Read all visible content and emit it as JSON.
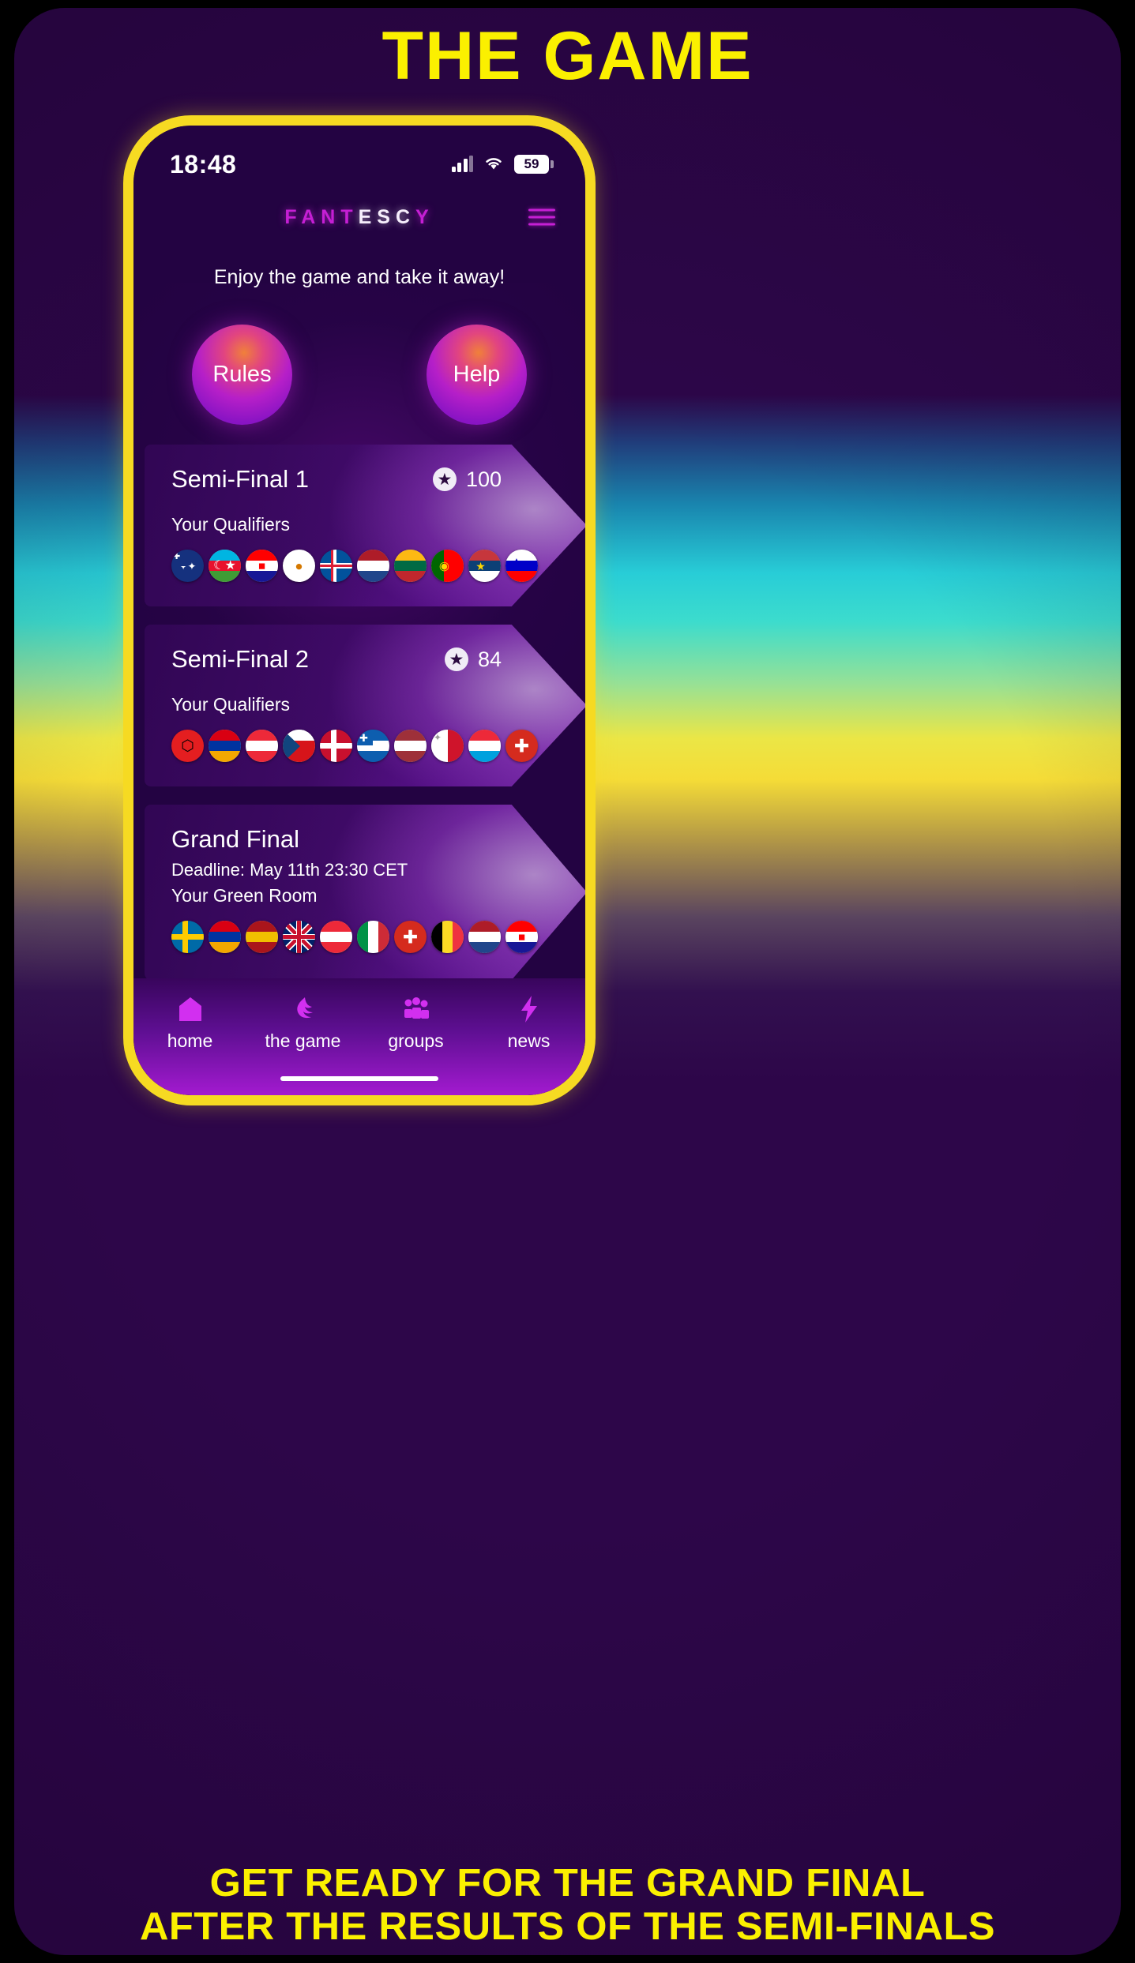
{
  "poster": {
    "headline": "THE GAME",
    "caption_line1": "GET READY FOR THE GRAND FINAL",
    "caption_line2": "AFTER THE RESULTS OF THE SEMI-FINALS",
    "accent_yellow": "#fbf000",
    "frame_yellow": "#f6da22",
    "background_purple": "#2d0649"
  },
  "status_bar": {
    "time": "18:48",
    "signal_icon": "cellular-signal-icon",
    "wifi_icon": "wifi-icon",
    "battery_level": "59"
  },
  "app_header": {
    "logo_part1": "FANT",
    "logo_part2": "ESC",
    "logo_part3": "Y",
    "menu_icon": "hamburger-menu-icon"
  },
  "tagline": "Enjoy the game and take it away!",
  "orbs": [
    {
      "label": "Rules",
      "name": "rules-button"
    },
    {
      "label": "Help",
      "name": "help-button"
    }
  ],
  "cards": [
    {
      "title": "Semi-Final 1",
      "score": "100",
      "star_icon": "star-badge-icon",
      "subtitle": "Your Qualifiers",
      "deadline": "",
      "flags": [
        {
          "country": "Australia",
          "code": "AU"
        },
        {
          "country": "Azerbaijan",
          "code": "AZ"
        },
        {
          "country": "Croatia",
          "code": "HR"
        },
        {
          "country": "Cyprus",
          "code": "CY"
        },
        {
          "country": "Iceland",
          "code": "IS"
        },
        {
          "country": "Netherlands",
          "code": "NL"
        },
        {
          "country": "Lithuania",
          "code": "LT"
        },
        {
          "country": "Portugal",
          "code": "PT"
        },
        {
          "country": "Serbia",
          "code": "RS"
        },
        {
          "country": "Slovenia",
          "code": "SI"
        }
      ]
    },
    {
      "title": "Semi-Final 2",
      "score": "84",
      "star_icon": "star-badge-icon",
      "subtitle": "Your Qualifiers",
      "deadline": "",
      "flags": [
        {
          "country": "Albania",
          "code": "AL"
        },
        {
          "country": "Armenia",
          "code": "AM"
        },
        {
          "country": "Austria",
          "code": "AT"
        },
        {
          "country": "Czechia",
          "code": "CZ"
        },
        {
          "country": "Denmark",
          "code": "DK"
        },
        {
          "country": "Greece",
          "code": "GR"
        },
        {
          "country": "Latvia",
          "code": "LV"
        },
        {
          "country": "Malta",
          "code": "MT"
        },
        {
          "country": "Luxembourg",
          "code": "LU"
        },
        {
          "country": "Switzerland",
          "code": "CH"
        }
      ]
    },
    {
      "title": "Grand Final",
      "score": "",
      "star_icon": "",
      "subtitle": "Your Green Room",
      "deadline": "Deadline: May 11th 23:30 CET",
      "flags": [
        {
          "country": "Sweden",
          "code": "SE"
        },
        {
          "country": "Armenia",
          "code": "AM"
        },
        {
          "country": "Spain",
          "code": "ES"
        },
        {
          "country": "United Kingdom",
          "code": "GB"
        },
        {
          "country": "Austria",
          "code": "AT"
        },
        {
          "country": "Italy",
          "code": "IT"
        },
        {
          "country": "Switzerland",
          "code": "CH"
        },
        {
          "country": "Belgium",
          "code": "BE"
        },
        {
          "country": "Netherlands",
          "code": "NL"
        },
        {
          "country": "Croatia",
          "code": "HR"
        }
      ]
    }
  ],
  "bottom_nav": [
    {
      "label": "home",
      "icon": "home-icon"
    },
    {
      "label": "the game",
      "icon": "bird-icon"
    },
    {
      "label": "groups",
      "icon": "people-group-icon"
    },
    {
      "label": "news",
      "icon": "lightning-bolt-icon"
    }
  ]
}
